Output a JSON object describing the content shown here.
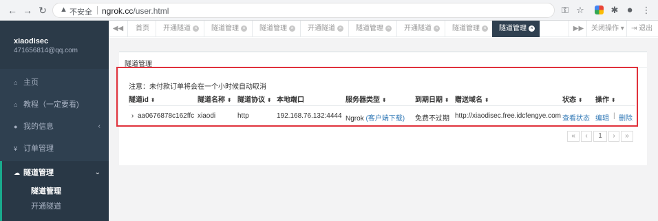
{
  "browser": {
    "back_icon": "back-arrow-icon",
    "forward_icon": "forward-arrow-icon",
    "reload_icon": "reload-icon",
    "insecure_label": "不安全",
    "url_host": "ngrok.cc",
    "url_path": "/user.html",
    "icons": [
      "key-icon",
      "star-icon",
      "extension-icon",
      "puzzle-icon",
      "profile-icon",
      "menu-icon"
    ]
  },
  "sidebar": {
    "username": "xiaodisec",
    "email": "471656814@qq.com",
    "items": [
      {
        "label": "主页",
        "icon": "home-icon"
      },
      {
        "label": "教程（一定要看)",
        "icon": "home-icon"
      },
      {
        "label": "我的信息",
        "icon": "user-icon",
        "chevron": "‹"
      },
      {
        "label": "订单管理",
        "icon": "yen-icon"
      },
      {
        "label": "隧道管理",
        "icon": "cloud-icon",
        "chevron": "⌄"
      }
    ],
    "sub_items": [
      {
        "label": "隧道管理"
      },
      {
        "label": "开通隧道"
      }
    ]
  },
  "tabs": {
    "items": [
      {
        "label": "首页",
        "closable": false
      },
      {
        "label": "开通隧道",
        "closable": true
      },
      {
        "label": "隧道管理",
        "closable": true
      },
      {
        "label": "隧道管理",
        "closable": true
      },
      {
        "label": "开通隧道",
        "closable": true
      },
      {
        "label": "隧道管理",
        "closable": true
      },
      {
        "label": "开通隧道",
        "closable": true
      },
      {
        "label": "隧道管理",
        "closable": true
      },
      {
        "label": "隧道管理",
        "closable": true,
        "active": true
      }
    ],
    "close_ops": "关闭操作",
    "logout": "退出"
  },
  "panel": {
    "title": "隧道管理",
    "notice": "注意：未付款订单将会在一个小时候自动取消",
    "columns": [
      "隧道id",
      "隧道名称",
      "隧道协议",
      "本地端口",
      "服务器类型",
      "到期日期",
      "赠送域名",
      "状态",
      "操作"
    ],
    "row": {
      "id": "aa0676878c162ffc",
      "name": "xiaodi",
      "protocol": "http",
      "local_port": "192.168.76.132:4444",
      "server_type": "Ngrok",
      "client_download": "(客户端下载)",
      "expiry": "免费不过期",
      "domain": "http://xiaodisec.free.idcfengye.com",
      "status_link": "查看状态",
      "edit_link": "编辑",
      "op_sep": "|",
      "delete_link": "删除"
    },
    "pagination": [
      "«",
      "‹",
      "1",
      "›",
      "»"
    ]
  },
  "colors": {
    "sidebar_bg": "#2f4050",
    "accent": "#19aa8d",
    "link": "#337ab7",
    "highlight_border": "#e0313b"
  }
}
